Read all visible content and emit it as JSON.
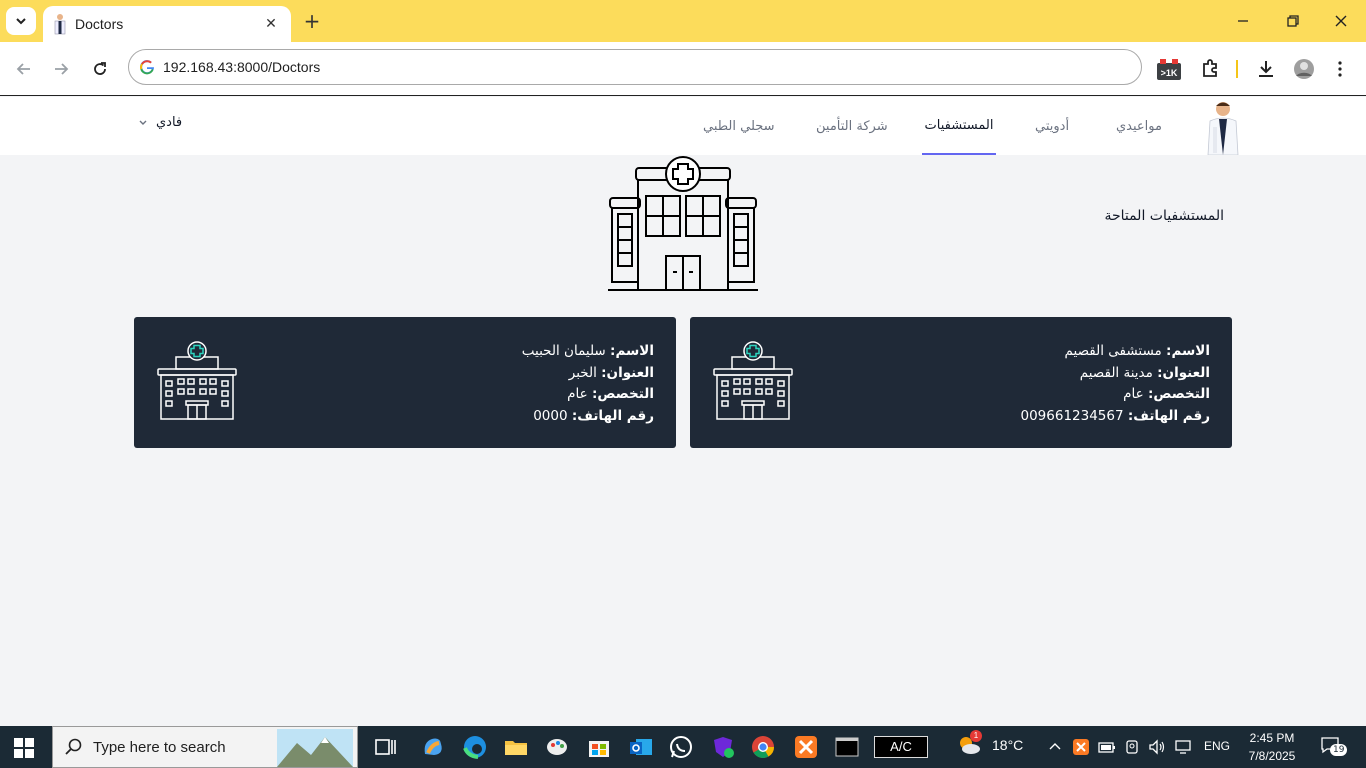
{
  "browser": {
    "tab_title": "Doctors",
    "url": "192.168.43:8000/Doctors",
    "ext_badge": ">1K"
  },
  "nav": {
    "links": [
      {
        "label": "مواعيدي"
      },
      {
        "label": "أدويتي"
      },
      {
        "label": "المستشفيات"
      },
      {
        "label": "شركة التأمين"
      },
      {
        "label": "سجلي الطبي"
      }
    ],
    "active_index": 2,
    "active_color": "#6366f1",
    "user_name": "فادي"
  },
  "main": {
    "section_title": "المستشفيات المتاحة",
    "labels": {
      "name": "الاسم:",
      "address": "العنوان:",
      "specialty": "التخصص:",
      "phone": "رقم الهاتف:"
    },
    "hospitals": [
      {
        "name": "مستشفى القصيم",
        "address": "مدينة القصيم",
        "specialty": "عام",
        "phone": "009661234567"
      },
      {
        "name": "سليمان الحبيب",
        "address": "الخبر",
        "specialty": "عام",
        "phone": "0000"
      }
    ],
    "card_color": "#1f2937",
    "icon_accent": "#2dd4bf"
  },
  "taskbar": {
    "search_placeholder": "Type here to search",
    "ac_label": "A/C",
    "weather_temp": "18°C",
    "weather_badge": "1",
    "language": "ENG",
    "time": "2:45 PM",
    "date": "7/8/2025",
    "notification_count": "19"
  }
}
